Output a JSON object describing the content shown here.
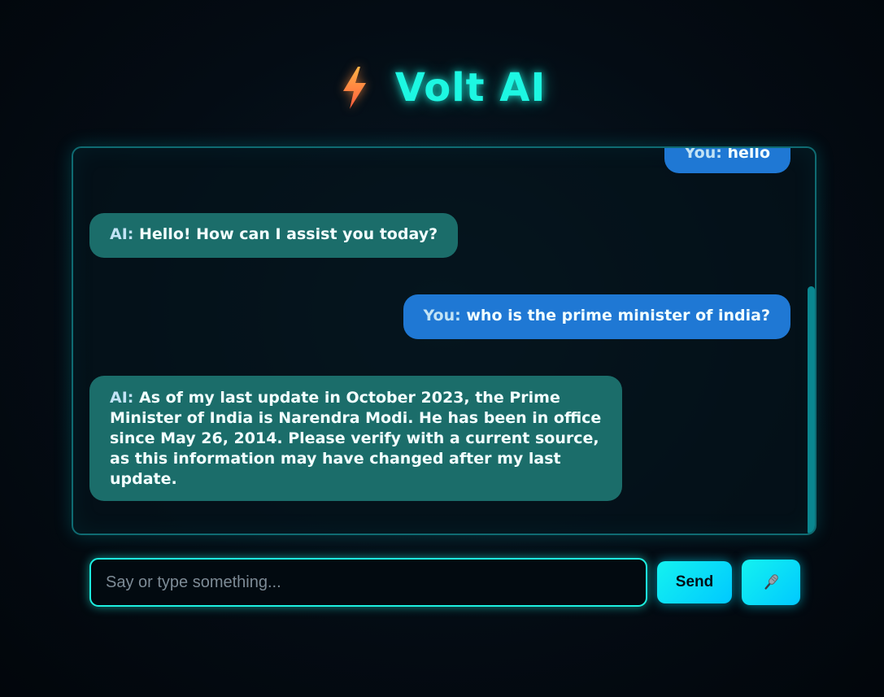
{
  "header": {
    "title": "Volt AI",
    "logo_icon": "lightning-bolt-icon"
  },
  "chat": {
    "messages": [
      {
        "role": "user",
        "speaker": "You:",
        "text": "hello"
      },
      {
        "role": "ai",
        "speaker": "AI:",
        "text": "Hello! How can I assist you today?"
      },
      {
        "role": "user",
        "speaker": "You:",
        "text": "who is the prime minister of india?"
      },
      {
        "role": "ai",
        "speaker": "AI:",
        "text": "As of my last update in October 2023, the Prime Minister of India is Narendra Modi. He has been in office since May 26, 2014. Please verify with a current source, as this information may have changed after my last update."
      }
    ]
  },
  "composer": {
    "placeholder": "Say or type something...",
    "send_label": "Send",
    "mic_icon": "microphone-icon"
  },
  "colors": {
    "accent": "#1df7e2",
    "user_bubble": "#1f78d4",
    "ai_bubble": "#1b6d6a",
    "button": "#14f2f0"
  }
}
